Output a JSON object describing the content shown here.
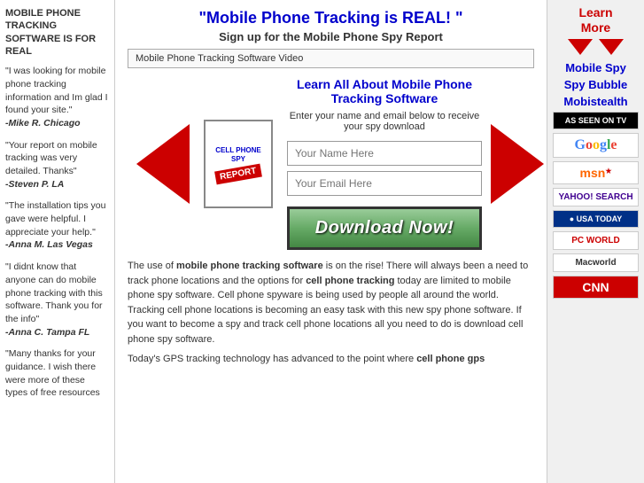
{
  "left_sidebar": {
    "site_title": "Mobile Phone Tracking Software is for REAL",
    "testimonials": [
      {
        "text": "\"I was looking for mobile phone tracking information and Im glad I found your site.\"",
        "author": "-Mike R. Chicago"
      },
      {
        "text": "\"Your report on mobile tracking was very detailed. Thanks\"",
        "author": "-Steven P. LA"
      },
      {
        "text": "\"The installation tips you gave were helpful. I appreciate your help.\"",
        "author": "-Anna M. Las Vegas"
      },
      {
        "text": "\"I didnt know that anyone can do mobile phone tracking with this software. Thank you for the info\"",
        "author": "-Anna C. Tampa FL"
      },
      {
        "text": "\"Many thanks for your guidance. I wish there were more of these types of free resources",
        "author": ""
      }
    ]
  },
  "main": {
    "headline": "\"Mobile Phone Tracking is REAL! \"",
    "subheadline": "Sign up for the Mobile Phone Spy Report",
    "video_bar": "Mobile Phone Tracking Software Video",
    "book_title_line1": "CELL PHONE",
    "book_title_line2": "SPY",
    "book_label": "REPORT",
    "form_section_title": "Learn All About Mobile Phone Tracking Software",
    "form_section_sub": "Enter your name and email below to receive your spy download",
    "name_placeholder": "Your Name Here",
    "email_placeholder": "Your Email Here",
    "download_btn": "Download Now!"
  },
  "body_text": {
    "paragraph1": "The use of mobile phone tracking software is on the rise! There will always been a need to track phone locations and the options for cell phone tracking today are limited to mobile phone spy software. Cell phone spyware is being used by people all around the world. Tracking cell phone locations is becoming an easy task with this new spy phone software. If you want to become a spy and track cell phone locations all you need to do is download cell phone spy software.",
    "paragraph2": "Today's GPS tracking technology has advanced to the point where cell phone gps"
  },
  "right_sidebar": {
    "learn_more": "Learn\nMore",
    "links": [
      {
        "label": "Mobile Spy"
      },
      {
        "label": "Spy Bubble"
      },
      {
        "label": "Mobistealth"
      }
    ],
    "logos": [
      {
        "name": "As Seen on TV",
        "type": "astv"
      },
      {
        "name": "Google",
        "type": "google"
      },
      {
        "name": "MSN",
        "type": "msn"
      },
      {
        "name": "Yahoo! Search",
        "type": "yahoo"
      },
      {
        "name": "USA Today",
        "type": "usatoday"
      },
      {
        "name": "PC World",
        "type": "pcworld"
      },
      {
        "name": "Macworld",
        "type": "macworld"
      },
      {
        "name": "CNN",
        "type": "cnn"
      }
    ]
  }
}
